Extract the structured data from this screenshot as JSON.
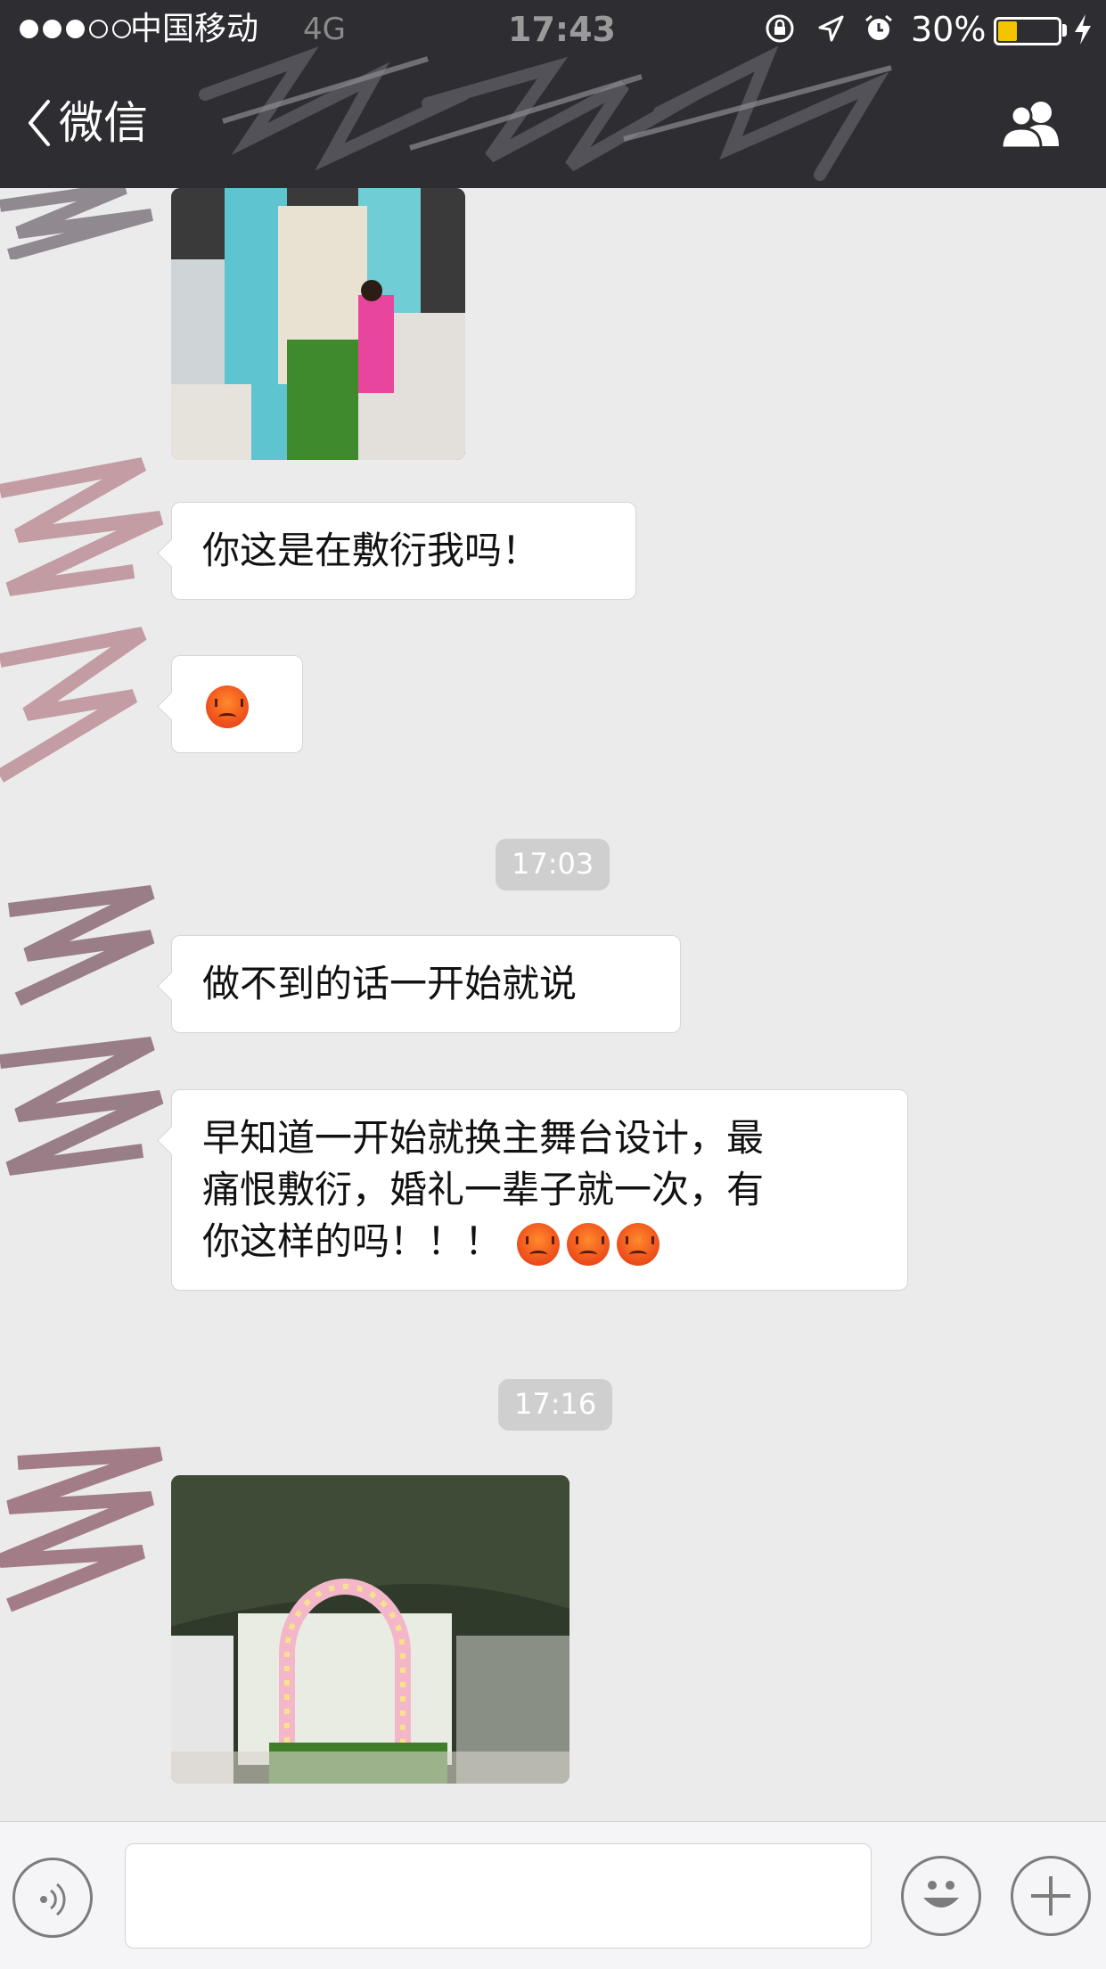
{
  "status_bar": {
    "carrier": "中国移动",
    "network": "4G",
    "time": "17:43",
    "battery_percent": "30%",
    "battery_level": 0.3,
    "icons": [
      "signal-dots-icon",
      "orientation-lock-icon",
      "location-arrow-icon",
      "alarm-icon",
      "battery-icon",
      "charging-bolt-icon"
    ]
  },
  "nav": {
    "back_label": "微信",
    "back_icon": "chevron-left-icon",
    "right_icon": "group-members-icon"
  },
  "messages": [
    {
      "type": "image",
      "description_icon": "photo-wedding-aisle"
    },
    {
      "type": "text",
      "text": "你这是在敷衍我吗！"
    },
    {
      "type": "emoji",
      "emoji": "😡"
    },
    {
      "type": "timestamp",
      "text": "17:03"
    },
    {
      "type": "text",
      "text": "做不到的话一开始就说"
    },
    {
      "type": "text",
      "lines": [
        "早知道一开始就换主舞台设计，最",
        "痛恨敷衍，婚礼一辈子就一次，有",
        "你这样的吗！！！"
      ],
      "emoji_count": 3
    },
    {
      "type": "timestamp",
      "text": "17:16"
    },
    {
      "type": "image",
      "description_icon": "photo-floral-arch"
    }
  ],
  "input_bar": {
    "text_value": "",
    "voice_icon": "voice-icon",
    "emoji_icon": "smiley-icon",
    "plus_icon": "plus-icon"
  },
  "colors": {
    "topbar": "#2e2d32",
    "background": "#ebebeb",
    "bubble": "#ffffff",
    "timestamp_bg": "#cfcfcf",
    "battery_fill": "#f5c400"
  }
}
